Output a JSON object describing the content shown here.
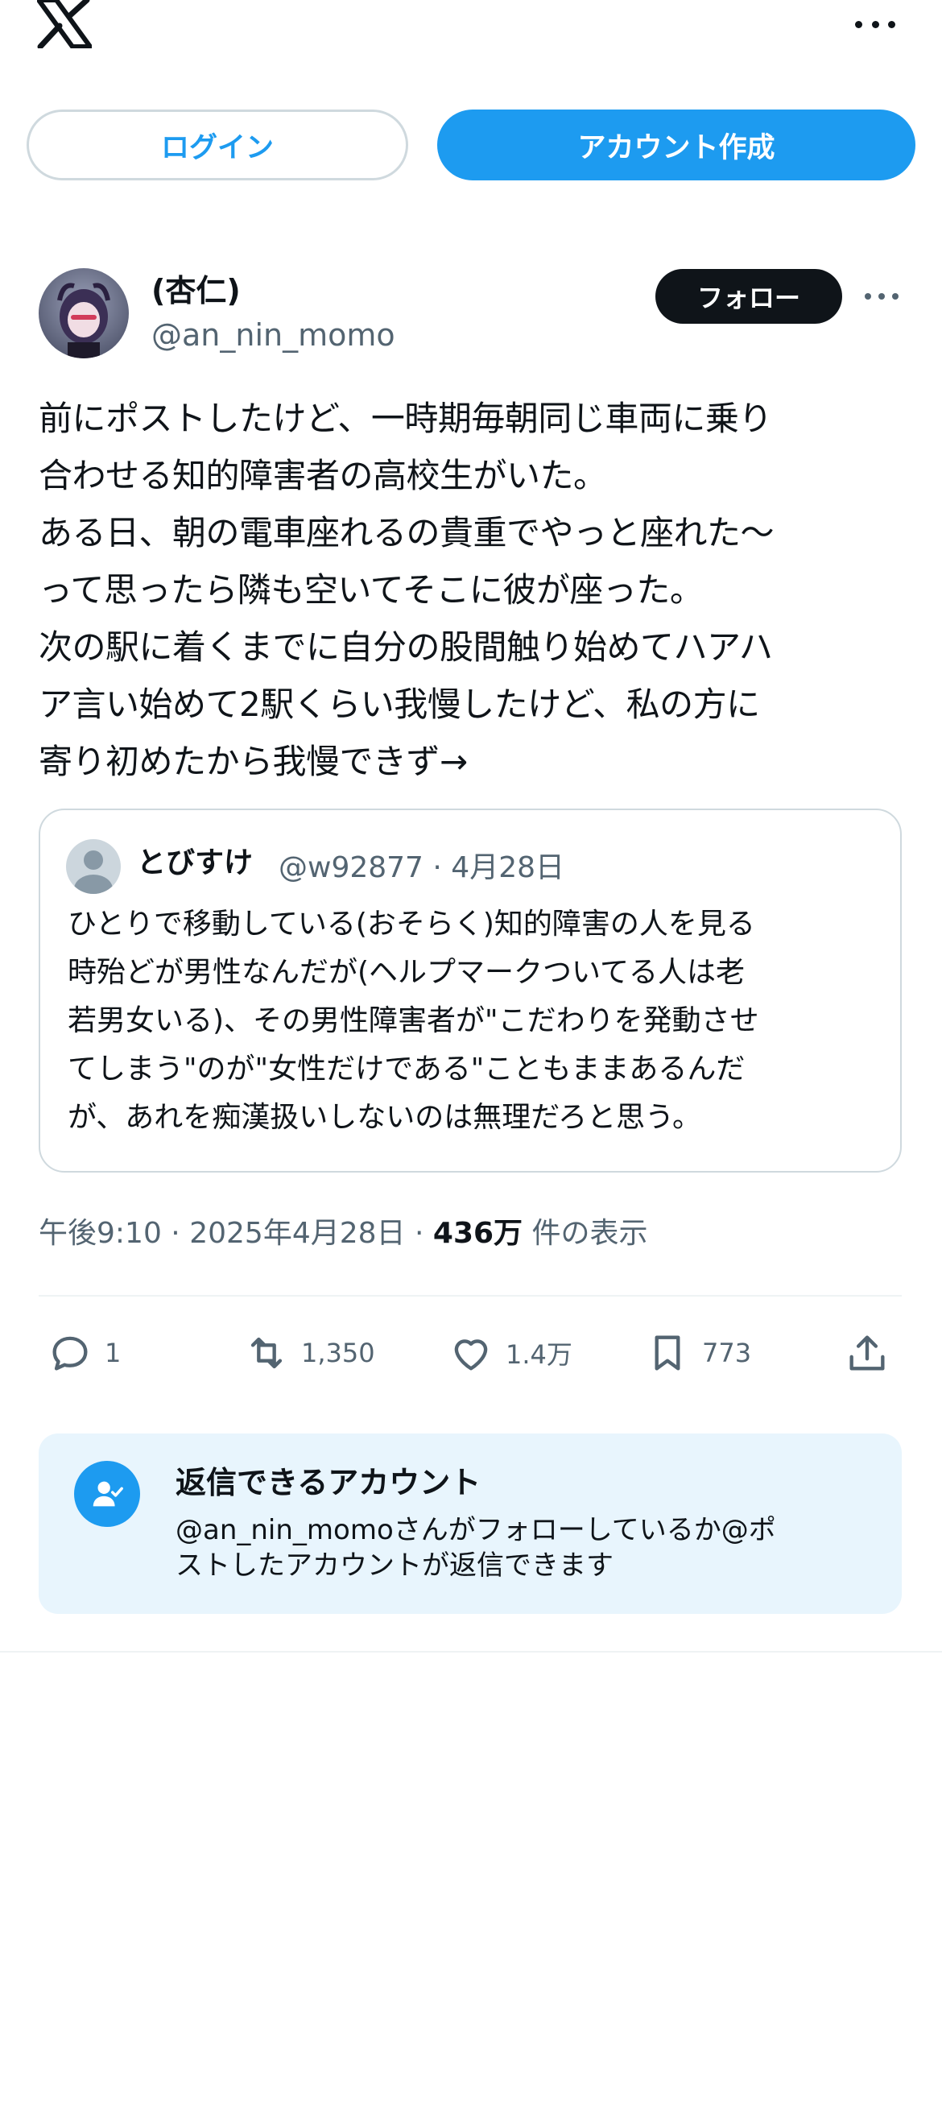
{
  "header": {
    "logo_icon": "x-logo-icon",
    "more_icon": "more-horizontal-icon"
  },
  "auth": {
    "login_label": "ログイン",
    "signup_label": "アカウント作成"
  },
  "post": {
    "display_name": "(杏仁)",
    "handle": "@an_nin_momo",
    "follow_label": "フォロー",
    "text": "前にポストしたけど、一時期毎朝同じ車両に乗り\n合わせる知的障害者の高校生がいた。\nある日、朝の電車座れるの貴重でやっと座れた〜\nって思ったら隣も空いてそこに彼が座った。\n次の駅に着くまでに自分の股間触り始めてハアハ\nア言い始めて2駅くらい我慢したけど、私の方に\n寄り初めたから我慢できず→",
    "time": "午後9:10",
    "date": "2025年4月28日",
    "views_count": "436万",
    "views_label": "件の表示",
    "dot": "·"
  },
  "quote": {
    "name": "とびすけ",
    "meta": "@w92877 · 4月28日",
    "text": "ひとりで移動している(おそらく)知的障害の人を見る\n時殆どが男性なんだが(ヘルプマークついてる人は老\n若男女いる)、その男性障害者が\"こだわりを発動させ\nてしまう\"のが\"女性だけである\"こともままあるんだ\nが、あれを痴漢扱いしないのは無理だろと思う。"
  },
  "actions": {
    "replies": "1",
    "reposts": "1,350",
    "likes": "1.4万",
    "bookmarks": "773"
  },
  "reply_notice": {
    "title": "返信できるアカウント",
    "body": "@an_nin_momoさんがフォローしているか@ポ\nストしたアカウントが返信できます"
  },
  "colors": {
    "accent": "#1d9bf0",
    "text": "#0f1419",
    "secondary": "#536471",
    "notice_bg": "#e8f5fd"
  }
}
